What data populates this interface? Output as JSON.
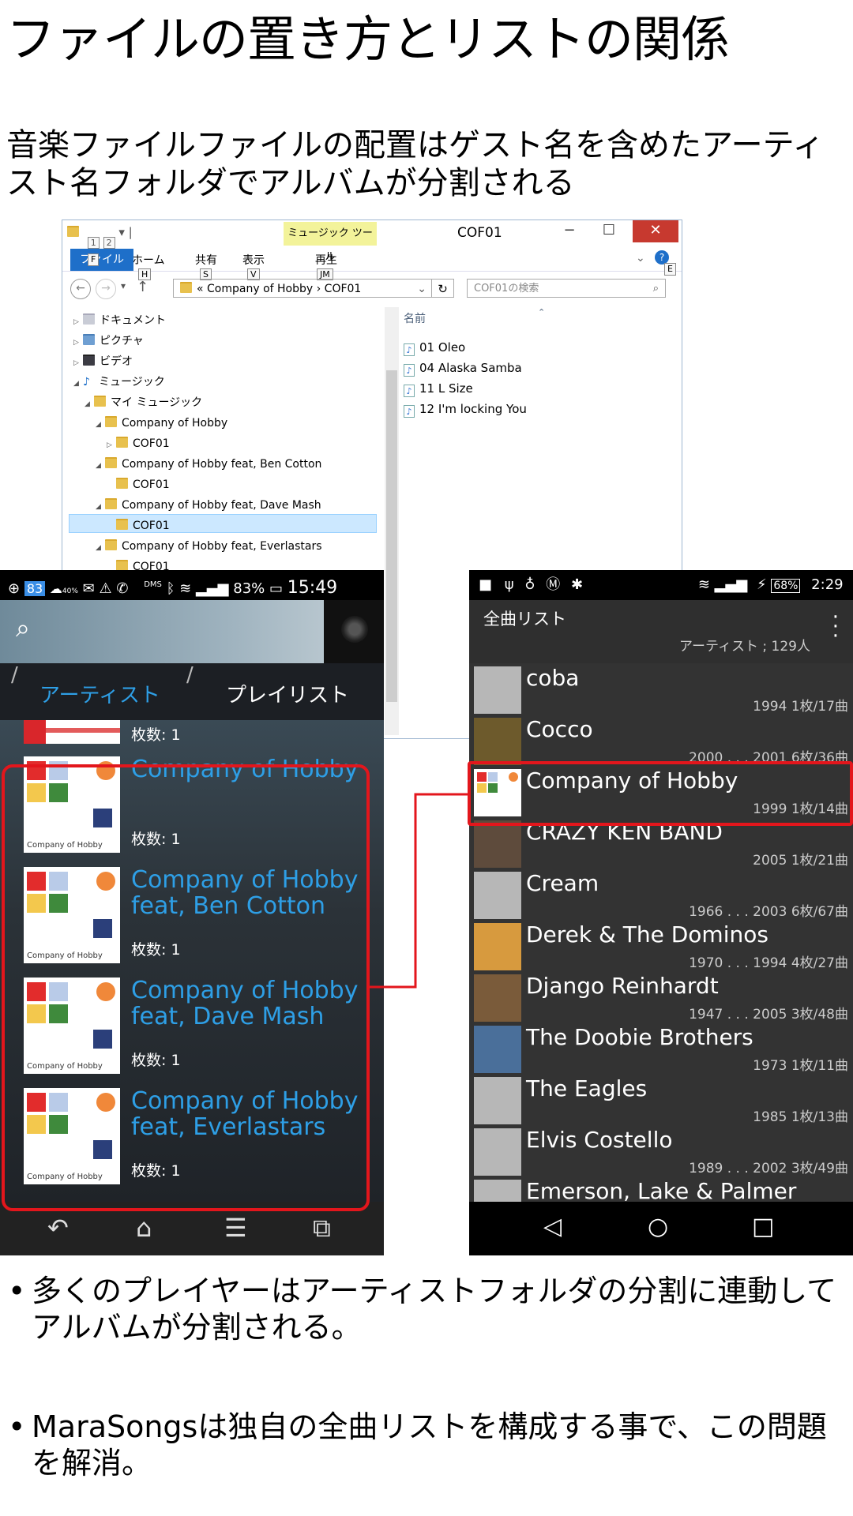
{
  "slide": {
    "title": "ファイルの置き方とリストの関係",
    "subtitle": "音楽ファイルファイルの配置はゲスト名を含めたアーティスト名フォルダでアルバムが分割される",
    "bullets": [
      "多くのプレイヤーはアーティストフォルダの分割に連動してアルバムが分割される。",
      "MaraSongsは独自の全曲リストを構成する事で、この問題を解消。"
    ]
  },
  "explorer": {
    "window_title": "COF01",
    "context_tab": "ミュージック ツール",
    "ribbon_tabs": [
      {
        "label": "ファイル",
        "key": "F"
      },
      {
        "label": "ホーム",
        "key": "H"
      },
      {
        "label": "共有",
        "key": "S"
      },
      {
        "label": "表示",
        "key": "V"
      },
      {
        "label": "再生",
        "key": "JM"
      }
    ],
    "qat_keys": [
      "1",
      "2"
    ],
    "help_key": "E",
    "address_path": "« Company of Hobby › COF01",
    "search_placeholder": "COF01の検索",
    "column_name": "名前",
    "tree": [
      "ドキュメント",
      "ピクチャ",
      "ビデオ",
      "ミュージック",
      "マイ ミュージック",
      "Company of Hobby",
      "COF01",
      "Company of Hobby feat, Ben Cotton",
      "COF01",
      "Company of Hobby feat, Dave Mash",
      "COF01",
      "Company of Hobby feat, Everlastars",
      "COF01"
    ],
    "files": [
      "01 Oleo",
      "04 Alaska Samba",
      "11 L Size",
      "12 I'm locking You"
    ]
  },
  "left_phone": {
    "status": {
      "left": "83",
      "dms": "DMS",
      "battery": "83%",
      "time": "15:49",
      "weather_pct": "40%"
    },
    "tabs": [
      "アーティスト",
      "プレイリスト"
    ],
    "partial_count": "枚数: 1",
    "albums": [
      {
        "name_line1": "Company of Hobby",
        "name_line2": "",
        "count": "枚数: 1",
        "cover_caption": "Company of Hobby"
      },
      {
        "name_line1": "Company of Hobby",
        "name_line2": "feat, Ben Cotton",
        "count": "枚数: 1",
        "cover_caption": "Company of Hobby"
      },
      {
        "name_line1": "Company of Hobby",
        "name_line2": "feat, Dave Mash",
        "count": "枚数: 1",
        "cover_caption": "Company of Hobby"
      },
      {
        "name_line1": "Company of Hobby",
        "name_line2": "feat, Everlastars",
        "count": "枚数: 1",
        "cover_caption": "Company of Hobby"
      }
    ],
    "accent_color": "#2e9fe6"
  },
  "right_phone": {
    "status": {
      "battery": "68%",
      "time": "2:29"
    },
    "header_title": "全曲リスト",
    "header_sub": "アーティスト ; 129人",
    "artists": [
      {
        "name": "coba",
        "meta": "1994  1枚/17曲"
      },
      {
        "name": "Cocco",
        "meta": "2000 . . . 2001  6枚/36曲"
      },
      {
        "name": "Company of Hobby",
        "meta": "1999  1枚/14曲"
      },
      {
        "name": "CRAZY KEN BAND",
        "meta": "2005  1枚/21曲"
      },
      {
        "name": "Cream",
        "meta": "1966 . . . 2003  6枚/67曲"
      },
      {
        "name": "Derek & The Dominos",
        "meta": "1970 . . . 1994  4枚/27曲"
      },
      {
        "name": "Django Reinhardt",
        "meta": "1947 . . . 2005  3枚/48曲"
      },
      {
        "name": "The Doobie Brothers",
        "meta": "1973  1枚/11曲"
      },
      {
        "name": "The Eagles",
        "meta": "1985  1枚/13曲"
      },
      {
        "name": "Elvis Costello",
        "meta": "1989 . . . 2002  3枚/49曲"
      },
      {
        "name": "Emerson, Lake & Palmer",
        "meta": ""
      }
    ],
    "highlight_color": "#e3161c"
  }
}
